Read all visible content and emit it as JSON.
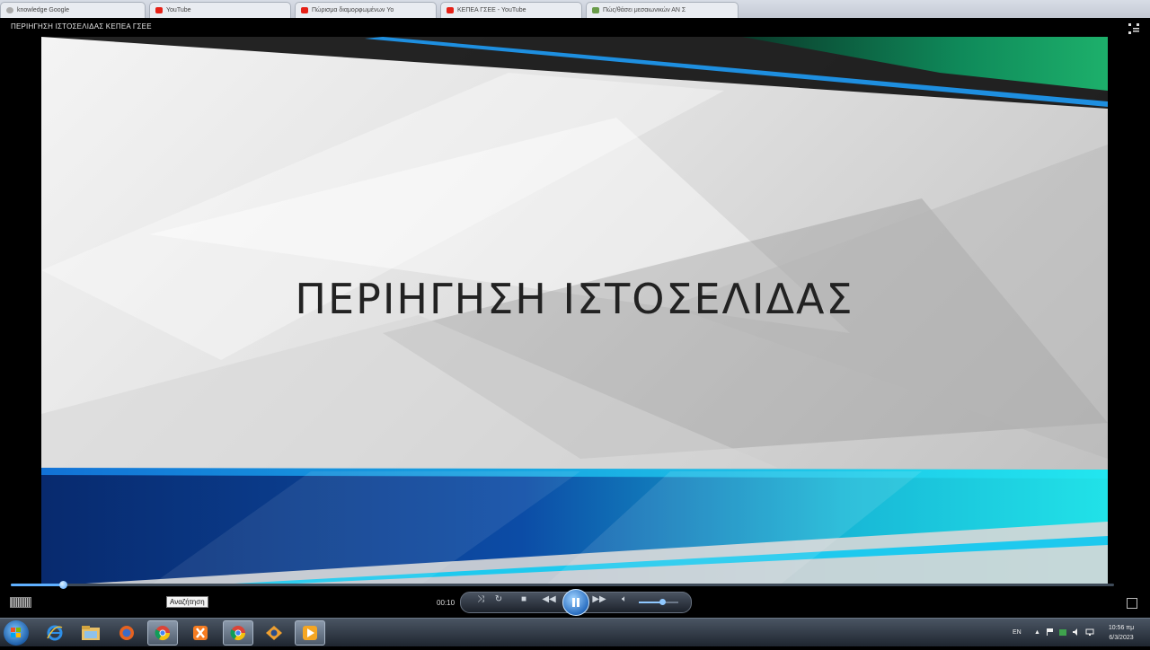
{
  "browser_tabs": [
    {
      "label": "knowledge Google"
    },
    {
      "label": "YouTube"
    },
    {
      "label": "Πώρισμα διαμορφωμένων Yo"
    },
    {
      "label": "ΚΕΠΕΑ ΓΣΕΕ - YouTube"
    },
    {
      "label": "Πώς/θάσει μεσαιωνικών ΑΝ Σ"
    }
  ],
  "player": {
    "title": "ΠΕΡΙΗΓΗΣΗ ΙΣΤΟΣΕΛΙΔΑΣ ΚΕΠΕΑ ΓΣΕΕ",
    "slide_title": "ΠΕΡΙΗΓΗΣΗ ΙΣΤΟΣΕΛΙΔΑΣ",
    "elapsed": "00:10",
    "tooltip": "Αναζήτηση",
    "seek_progress": 0.047,
    "volume": 0.6
  },
  "taskbar": {
    "apps": [
      "ie-icon",
      "explorer-icon",
      "firefox-icon",
      "chrome-icon",
      "xampp-icon",
      "chrome-icon",
      "paint-icon",
      "media-player-icon"
    ],
    "language": "EN",
    "time": "10:56 πμ",
    "date": "6/3/2023"
  },
  "colors": {
    "accent_blue": "#0c3a8c",
    "accent_cyan": "#19d3e0",
    "accent_green": "#1aa36b"
  }
}
